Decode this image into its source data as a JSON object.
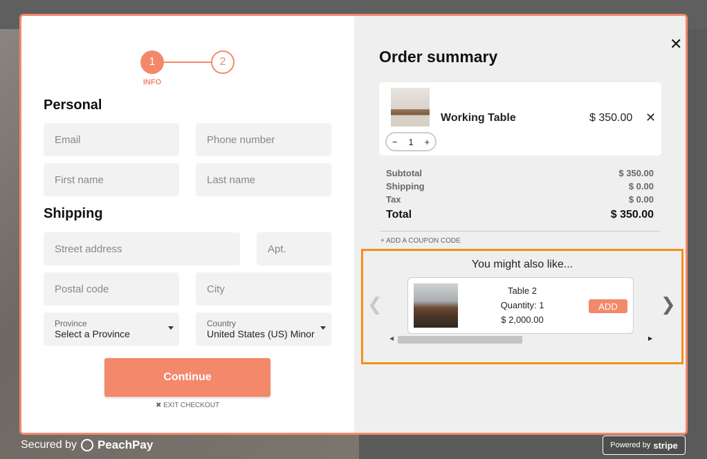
{
  "steps": [
    {
      "number": "1",
      "label": "INFO"
    },
    {
      "number": "2"
    }
  ],
  "personal": {
    "title": "Personal",
    "email_placeholder": "Email",
    "phone_placeholder": "Phone number",
    "first_name_placeholder": "First name",
    "last_name_placeholder": "Last name"
  },
  "shipping": {
    "title": "Shipping",
    "street_placeholder": "Street address",
    "apt_placeholder": "Apt.",
    "postal_placeholder": "Postal code",
    "city_placeholder": "City",
    "province_label": "Province",
    "province_value": "Select a Province",
    "country_label": "Country",
    "country_value": "United States (US) Minor Outlying Islands"
  },
  "continue_label": "Continue",
  "exit_label": "EXIT CHECKOUT",
  "order": {
    "title": "Order summary",
    "item": {
      "name": "Working Table",
      "price": "$ 350.00",
      "quantity": "1"
    },
    "summary": [
      {
        "label": "Subtotal",
        "value": "$ 350.00"
      },
      {
        "label": "Shipping",
        "value": "$ 0.00"
      },
      {
        "label": "Tax",
        "value": "$ 0.00"
      }
    ],
    "total": {
      "label": "Total",
      "value": "$ 350.00"
    },
    "coupon_label": "+ ADD A COUPON CODE"
  },
  "upsell": {
    "title": "You might also like...",
    "product": {
      "name": "Table 2",
      "quantity": "Quantity: 1",
      "price": "$ 2,000.00",
      "add_label": "ADD"
    }
  },
  "footer": {
    "secured_label": "Secured by",
    "brand": "PeachPay",
    "powered_by": "Powered by",
    "stripe": "stripe"
  },
  "colors": {
    "accent": "#f4886a",
    "highlight": "#f39018"
  }
}
